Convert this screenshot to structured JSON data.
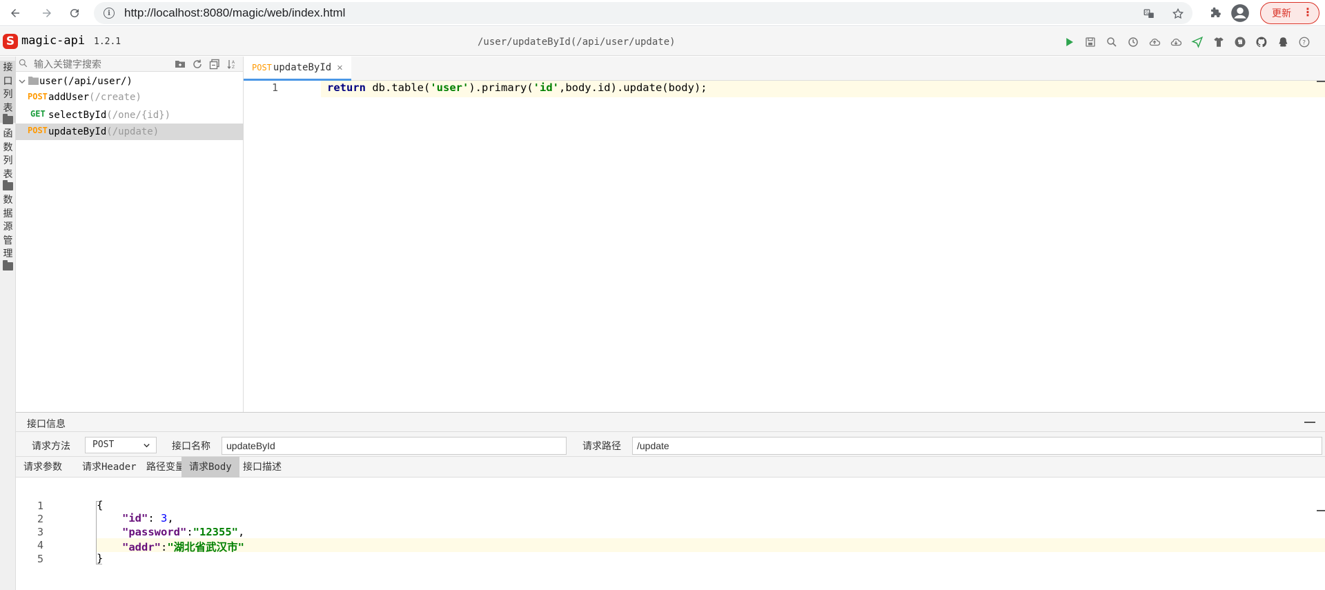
{
  "browser": {
    "url": "http://localhost:8080/magic/web/index.html",
    "update_label": "更新"
  },
  "app": {
    "name": "magic-api",
    "version": "1.2.1",
    "current_path": "/user/updateById(/api/user/update)"
  },
  "side_nav": [
    {
      "label": "接\n口\n列\n表"
    },
    {
      "label": "函\n数\n列\n表"
    },
    {
      "label": "数\n据\n源\n管\n理"
    }
  ],
  "tree": {
    "search_placeholder": "输入关键字搜索",
    "group": {
      "name": "user",
      "path": "(/api/user/)"
    },
    "items": [
      {
        "method": "POST",
        "name": "addUser",
        "path": "(/create)"
      },
      {
        "method": "GET",
        "name": "selectById",
        "path": "(/one/{id})"
      },
      {
        "method": "POST",
        "name": "updateById",
        "path": "(/update)"
      }
    ]
  },
  "editor": {
    "tab": {
      "method": "POST",
      "name": "updateById"
    },
    "lines": [
      {
        "num": "1"
      }
    ],
    "code": {
      "return_kw": "return",
      "part1": " db.table(",
      "str1": "'user'",
      "part2": ").primary(",
      "str2": "'id'",
      "part3": ",body.id).update(body);"
    }
  },
  "bottom": {
    "title": "接口信息",
    "method_label": "请求方法",
    "method_value": "POST",
    "name_label": "接口名称",
    "name_value": "updateById",
    "path_label": "请求路径",
    "path_value": "/update",
    "tabs": [
      "请求参数",
      "请求Header",
      "路径变量",
      "请求Body",
      "接口描述"
    ],
    "body_lines": [
      "1",
      "2",
      "3",
      "4",
      "5"
    ],
    "body": {
      "open": "{",
      "id_key": "\"id\"",
      "id_sep": ": ",
      "id_val": "3",
      "id_end": ",",
      "pw_key": "\"password\"",
      "pw_sep": ":",
      "pw_val": "\"12355\"",
      "pw_end": ",",
      "addr_key": "\"addr\"",
      "addr_sep": ":",
      "addr_val": "\"湖北省武汉市\"",
      "close": "}"
    }
  },
  "colors": {
    "post": "#ff9900",
    "get": "#1a9c3b",
    "accent": "#4b97e6"
  }
}
